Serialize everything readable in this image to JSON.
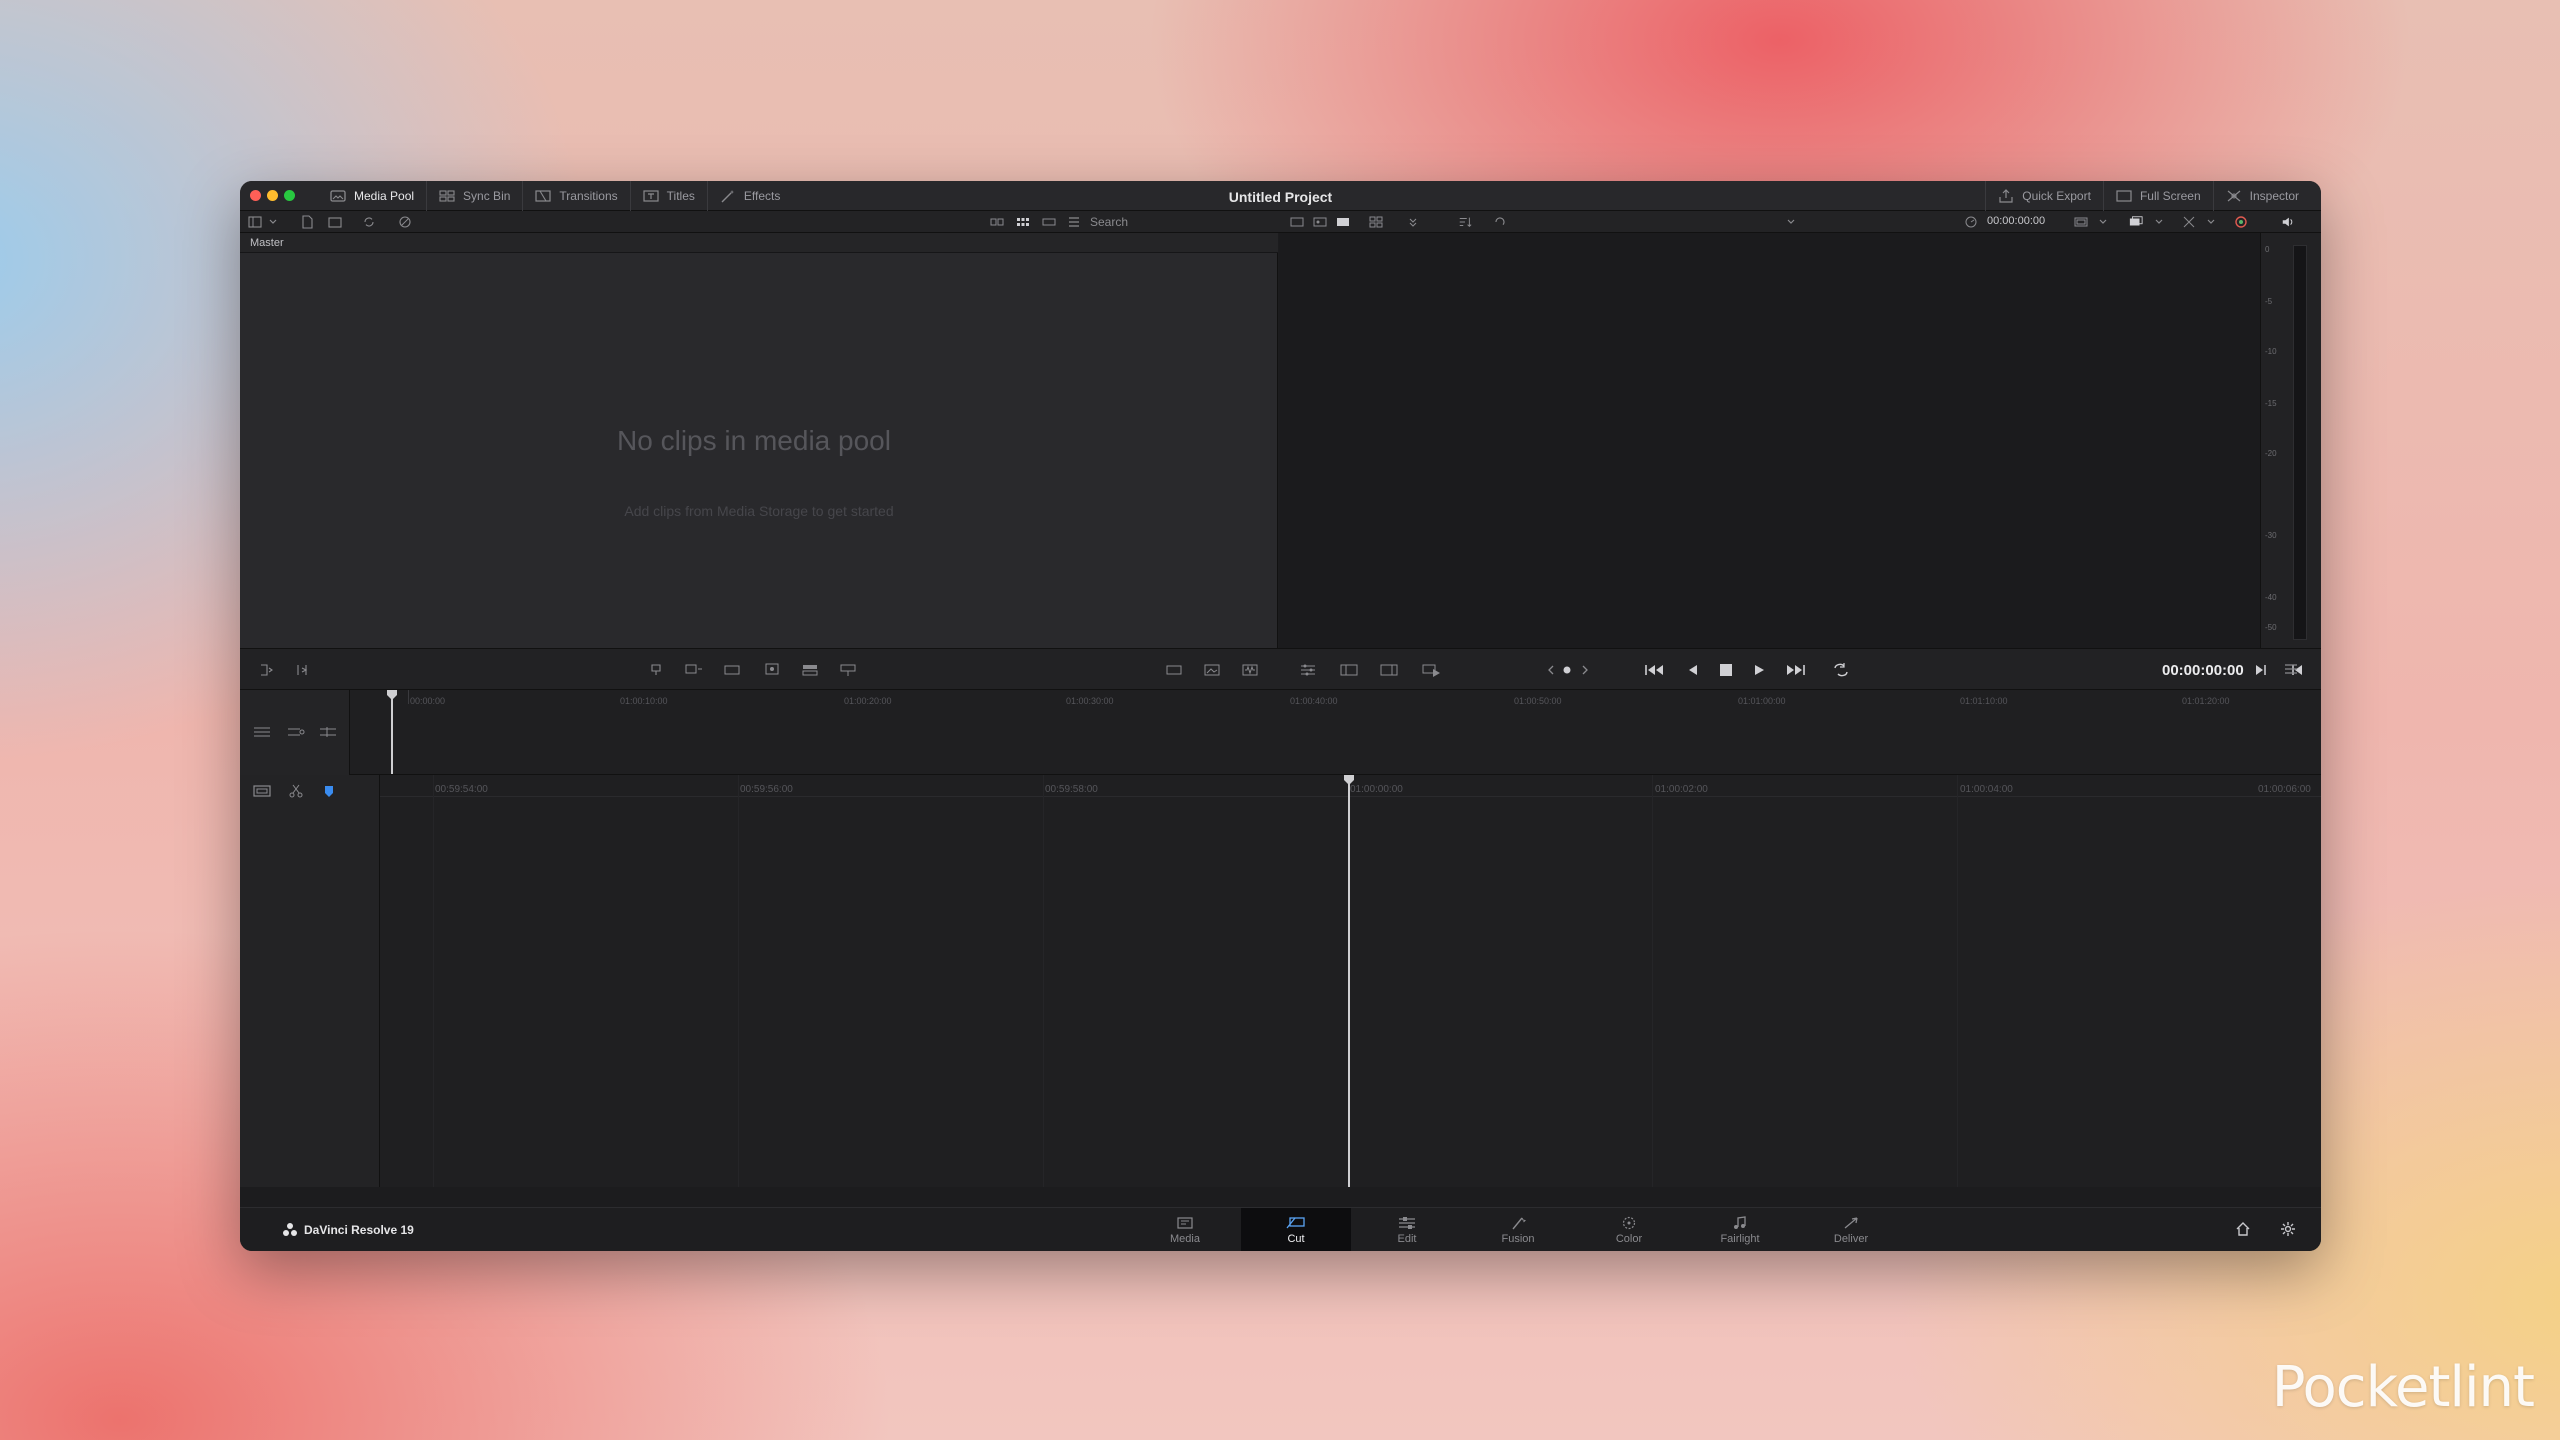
{
  "window": {
    "title": "Untitled Project",
    "traffic_colors": [
      "#ff5f57",
      "#febc2e",
      "#28c840"
    ]
  },
  "top_tabs": [
    {
      "label": "Media Pool",
      "icon": "media-pool-icon",
      "active": true
    },
    {
      "label": "Sync Bin",
      "icon": "sync-bin-icon"
    },
    {
      "label": "Transitions",
      "icon": "transitions-icon"
    },
    {
      "label": "Titles",
      "icon": "titles-icon"
    },
    {
      "label": "Effects",
      "icon": "effects-icon"
    }
  ],
  "top_right": [
    {
      "label": "Quick Export",
      "icon": "export-icon"
    },
    {
      "label": "Full Screen",
      "icon": "fullscreen-icon"
    },
    {
      "label": "Inspector",
      "icon": "inspector-icon"
    }
  ],
  "toolbar": {
    "search_placeholder": "Search",
    "viewer_timecode": "00:00:00:00"
  },
  "media_pool": {
    "bin": "Master",
    "empty_title": "No clips in media pool",
    "empty_hint": "Add clips from Media Storage to get started"
  },
  "vu_scale": [
    "0",
    "-5",
    "-10",
    "-15",
    "-20",
    "-30",
    "-40",
    "-50"
  ],
  "transport": {
    "timecode": "00:00:00:00"
  },
  "upper_ruler": [
    "00:00:00",
    "01:00:10:00",
    "01:00:20:00",
    "01:00:30:00",
    "01:00:40:00",
    "01:00:50:00",
    "01:01:00:00",
    "01:01:10:00",
    "01:01:20:00"
  ],
  "lower_ruler": [
    "00:59:54:00",
    "00:59:56:00",
    "00:59:58:00",
    "01:00:00:00",
    "01:00:02:00",
    "01:00:04:00",
    "01:00:06:00"
  ],
  "footer": {
    "brand": "DaVinci Resolve 19",
    "pages": [
      {
        "label": "Media",
        "icon": "media-page-icon"
      },
      {
        "label": "Cut",
        "icon": "cut-page-icon",
        "active": true
      },
      {
        "label": "Edit",
        "icon": "edit-page-icon"
      },
      {
        "label": "Fusion",
        "icon": "fusion-page-icon"
      },
      {
        "label": "Color",
        "icon": "color-page-icon"
      },
      {
        "label": "Fairlight",
        "icon": "fairlight-page-icon"
      },
      {
        "label": "Deliver",
        "icon": "deliver-page-icon"
      }
    ]
  },
  "watermark": "Pocketlint",
  "accent_color": "#3a8cf0"
}
